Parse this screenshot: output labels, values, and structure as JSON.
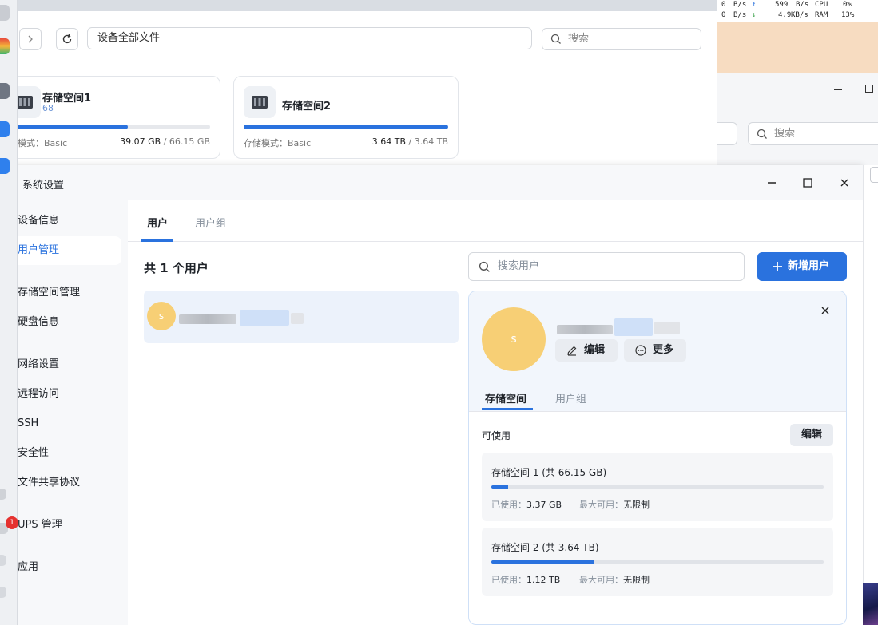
{
  "status_widget": {
    "row1": {
      "a": "0",
      "b": "B/s",
      "up_val": "599",
      "up_unit": "B/s",
      "k": "CPU",
      "v": "0%"
    },
    "row2": {
      "a": "0",
      "b": "B/s",
      "down_val": "4.9",
      "down_unit": "KB/s",
      "k": "RAM",
      "v": "13%"
    }
  },
  "file_manager": {
    "path": "设备全部文件",
    "search_placeholder": "搜索",
    "volumes": [
      {
        "name": "存储空间1",
        "sub": "68",
        "mode_label": "储模式：Basic",
        "used": "39.07 GB",
        "total": "/ 66.15 GB",
        "fraction": 0.59
      },
      {
        "name": "存储空间2",
        "sub": "",
        "mode_label": "存储模式：Basic",
        "used": "3.64 TB",
        "total": "/ 3.64 TB",
        "fraction": 1.0
      }
    ]
  },
  "second_window": {
    "search_placeholder": "搜索"
  },
  "settings": {
    "title": "系统设置",
    "nav": [
      {
        "label": "设备信息",
        "active": false
      },
      {
        "label": "用户管理",
        "active": true
      },
      {
        "label": "存储空间管理",
        "active": false
      },
      {
        "label": "硬盘信息",
        "active": false
      },
      {
        "label": "网络设置",
        "active": false
      },
      {
        "label": "远程访问",
        "active": false
      },
      {
        "label": "SSH",
        "active": false
      },
      {
        "label": "安全性",
        "active": false
      },
      {
        "label": "文件共享协议",
        "active": false
      },
      {
        "label": "UPS 管理",
        "active": false,
        "badge": "1"
      },
      {
        "label": "应用",
        "active": false
      }
    ],
    "tabs": {
      "users": "用户",
      "groups": "用户组"
    },
    "user_count": "共 1 个用户",
    "search_placeholder": "搜索用户",
    "add_user": "新增用户",
    "user": {
      "avatar_letter": "s"
    },
    "detail": {
      "avatar_letter": "s",
      "edit": "编辑",
      "more": "更多",
      "tab_storage": "存储空间",
      "tab_groups": "用户组",
      "available": "可使用",
      "edit_quota": "编辑",
      "quotas": [
        {
          "title": "存储空间 1 (共 66.15 GB)",
          "used_label": "已使用：",
          "used": "3.37 GB",
          "max_label": "最大可用：",
          "max": "无限制",
          "fraction": 0.05
        },
        {
          "title": "存储空间 2 (共 3.64 TB)",
          "used_label": "已使用：",
          "used": "1.12 TB",
          "max_label": "最大可用：",
          "max": "无限制",
          "fraction": 0.31
        }
      ]
    }
  },
  "colors": {
    "accent": "#2a72de",
    "avatar": "#f7cf75",
    "badge": "#e5312f"
  }
}
